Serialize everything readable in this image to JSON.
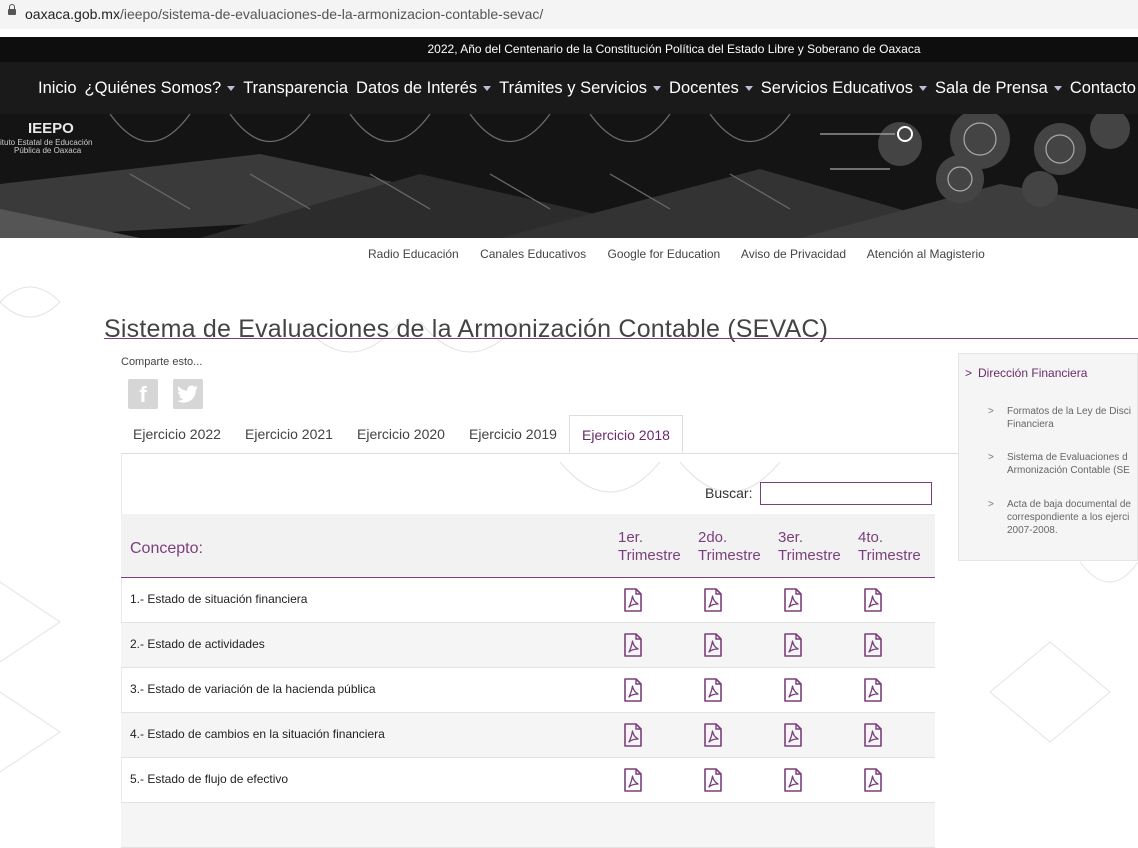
{
  "address_bar": {
    "host": "oaxaca.gob.mx",
    "path": "/ieepo/sistema-de-evaluaciones-de-la-armonizacion-contable-sevac/"
  },
  "top_banner": "2022, Año del Centenario de la Constitución Política del Estado Libre y Soberano de Oaxaca",
  "nav": {
    "items": [
      {
        "label": "Inicio",
        "dropdown": false
      },
      {
        "label": "¿Quiénes Somos?",
        "dropdown": true
      },
      {
        "label": "Transparencia",
        "dropdown": false
      },
      {
        "label": "Datos de Interés",
        "dropdown": true
      },
      {
        "label": "Trámites y Servicios",
        "dropdown": true
      },
      {
        "label": "Docentes",
        "dropdown": true
      },
      {
        "label": "Servicios Educativos",
        "dropdown": true
      },
      {
        "label": "Sala de Prensa",
        "dropdown": true
      },
      {
        "label": "Contacto",
        "dropdown": true
      }
    ]
  },
  "logo": {
    "name": "IEEPO",
    "line1": "ituto Estatal de Educación",
    "line2": "Pública de Oaxaca"
  },
  "subnav": {
    "items": [
      "Radio Educación",
      "Canales Educativos",
      "Google for Education",
      "Aviso de Privacidad",
      "Atención al Magisterio"
    ]
  },
  "page": {
    "title": "Sistema de Evaluaciones de la Armonización Contable (SEVAC)",
    "share_label": "Comparte esto...",
    "share_icons": [
      "facebook-icon",
      "twitter-icon"
    ]
  },
  "tabs": {
    "items": [
      "Ejercicio 2022",
      "Ejercicio 2021",
      "Ejercicio 2020",
      "Ejercicio 2019",
      "Ejercicio 2018"
    ],
    "active": "Ejercicio 2018"
  },
  "search": {
    "label": "Buscar:",
    "value": ""
  },
  "table": {
    "concept_header": "Concepto:",
    "quarter_headers": [
      {
        "line1": "1er.",
        "line2": "Trimestre"
      },
      {
        "line1": "2do.",
        "line2": "Trimestre"
      },
      {
        "line1": "3er.",
        "line2": "Trimestre"
      },
      {
        "line1": "4to.",
        "line2": "Trimestre"
      }
    ],
    "rows": [
      {
        "concept": "1.- Estado de situación financiera"
      },
      {
        "concept": "2.- Estado de actividades"
      },
      {
        "concept": "3.- Estado de variación de la hacienda pública"
      },
      {
        "concept": "4.- Estado de cambios en la situación financiera"
      },
      {
        "concept": "5.- Estado de flujo de efectivo"
      }
    ],
    "cell_icon": "pdf-icon",
    "accent_color": "#7b3f7c"
  },
  "sidebar": {
    "heading": "Dirección Financiera",
    "items": [
      {
        "line1": "Formatos de la Ley de Disci",
        "line2": "Financiera",
        "line3": ""
      },
      {
        "line1": "Sistema de Evaluaciones d",
        "line2": "Armonización Contable (SE",
        "line3": ""
      },
      {
        "line1": "Acta de baja documental de",
        "line2": "correspondiente a los ejerci",
        "line3": "2007-2008."
      }
    ]
  },
  "colors": {
    "accent": "#7b3f7c",
    "nav_bg": "#1a1a1a",
    "banner_bg": "#0e0e0e"
  }
}
